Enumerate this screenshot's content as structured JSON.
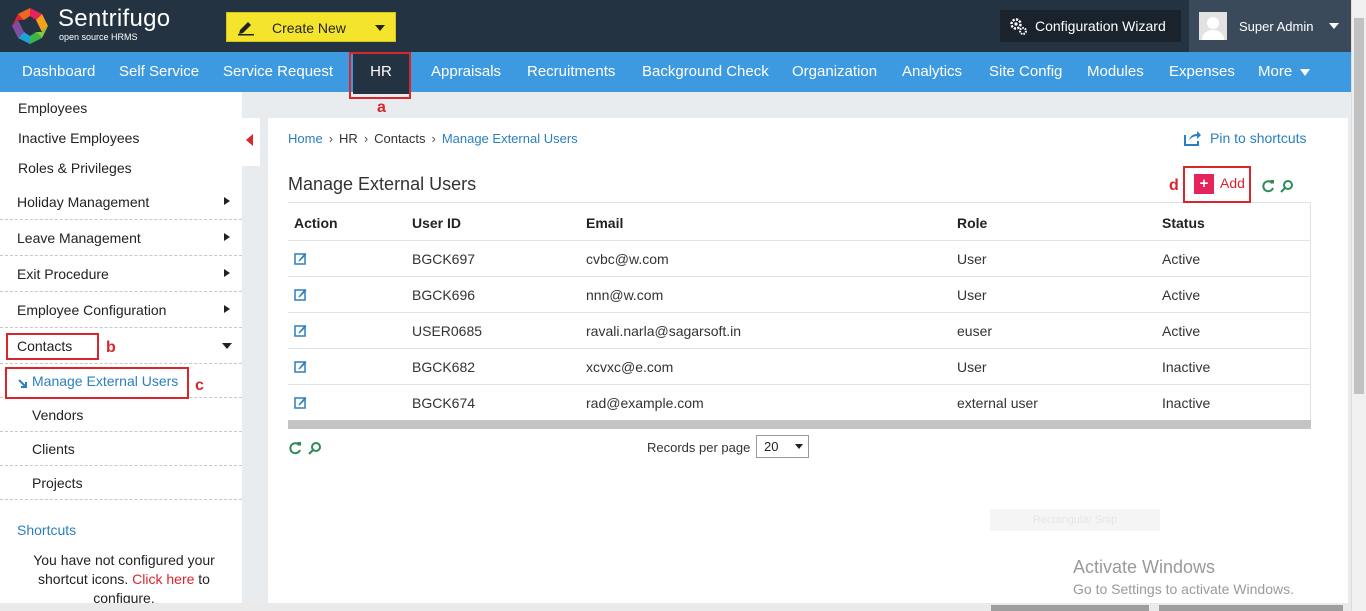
{
  "app": {
    "brand_name": "Sentrifugo",
    "brand_tagline": "open source HRMS",
    "create_new_label": "Create New",
    "config_wizard_label": "Configuration Wizard",
    "user_name": "Super Admin"
  },
  "nav": {
    "items": [
      "Dashboard",
      "Self Service",
      "Service Request",
      "HR",
      "Appraisals",
      "Recruitments",
      "Background Check",
      "Organization",
      "Analytics",
      "Site Config",
      "Modules",
      "Expenses",
      "More"
    ],
    "active": "HR"
  },
  "sidebar": {
    "top_links": [
      "Employees",
      "Inactive Employees",
      "Roles & Privileges"
    ],
    "groups": [
      "Holiday Management",
      "Leave Management",
      "Exit Procedure",
      "Employee Configuration",
      "Contacts"
    ],
    "contacts_children": [
      "Manage External Users",
      "Vendors",
      "Clients",
      "Projects"
    ],
    "active_child": "Manage External Users",
    "shortcuts_title": "Shortcuts",
    "shortcuts_msg_before": "You have not configured your shortcut icons. ",
    "shortcuts_link": "Click here",
    "shortcuts_msg_after": " to configure."
  },
  "breadcrumb": {
    "home": "Home",
    "hr": "HR",
    "contacts": "Contacts",
    "current": "Manage External Users",
    "separator": "›"
  },
  "main": {
    "pin_label": "Pin to shortcuts",
    "title": "Manage External Users",
    "add_label": "Add",
    "columns": [
      "Action",
      "User ID",
      "Email",
      "Role",
      "Status"
    ],
    "rows": [
      {
        "user_id": "BGCK697",
        "email": "cvbc@w.com",
        "role": "User",
        "status": "Active"
      },
      {
        "user_id": "BGCK696",
        "email": "nnn@w.com",
        "role": "User",
        "status": "Active"
      },
      {
        "user_id": "USER0685",
        "email": "ravali.narla@sagarsoft.in",
        "role": "euser",
        "status": "Active"
      },
      {
        "user_id": "BGCK682",
        "email": "xcvxc@e.com",
        "role": "User",
        "status": "Inactive"
      },
      {
        "user_id": "BGCK674",
        "email": "rad@example.com",
        "role": "external user",
        "status": "Inactive"
      }
    ],
    "records_per_page_label": "Records per page",
    "records_per_page_value": "20",
    "faint_box_text": "Rectangular Snip"
  },
  "overlay": {
    "activate_title": "Activate Windows",
    "activate_sub": "Go to Settings to activate Windows."
  },
  "annotations": {
    "a": "a",
    "b": "b",
    "c": "c",
    "d": "d",
    "color": "#d9262c"
  },
  "colors": {
    "header_bg": "#243342",
    "nav_bg": "#3e9ae0",
    "link": "#2b7fc0",
    "create_btn": "#f4e52c",
    "add_plus": "#e4245a"
  }
}
